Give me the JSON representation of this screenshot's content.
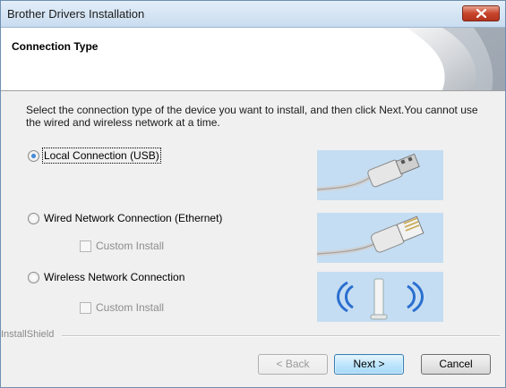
{
  "window": {
    "title": "Brother Drivers Installation"
  },
  "header": {
    "title": "Connection Type"
  },
  "instructions": "Select the connection type of the device you want to install, and then click Next.You cannot use the wired and wireless network at a time.",
  "options": [
    {
      "label": "Local Connection (USB)",
      "checked": true,
      "image": "usb-cable-icon"
    },
    {
      "label": "Wired Network Connection (Ethernet)",
      "checked": false,
      "image": "ethernet-cable-icon",
      "custom_install": {
        "label": "Custom Install",
        "checked": false,
        "enabled": false
      }
    },
    {
      "label": "Wireless Network Connection",
      "checked": false,
      "image": "wireless-access-point-icon",
      "custom_install": {
        "label": "Custom Install",
        "checked": false,
        "enabled": false
      }
    }
  ],
  "footer": {
    "installshield": "InstallShield"
  },
  "buttons": {
    "back": "< Back",
    "next": "Next >",
    "cancel": "Cancel"
  },
  "colors": {
    "picture_bg": "#b9d6ef",
    "accent": "#3c7fb1"
  }
}
